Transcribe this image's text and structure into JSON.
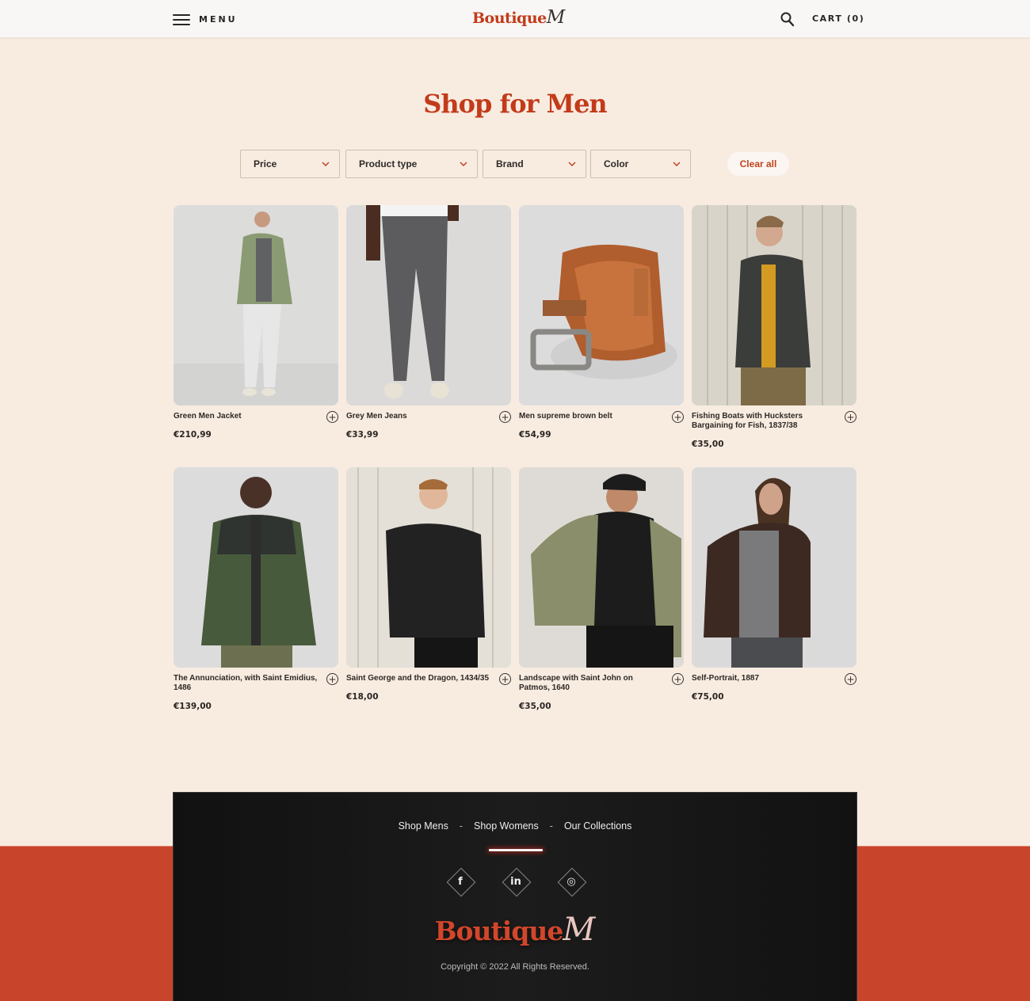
{
  "header": {
    "menu_label": "MENU",
    "logo_main": "Boutique",
    "logo_script": "M",
    "cart_label": "CART (0)",
    "icons": {
      "menu": "hamburger-icon",
      "search": "search-icon"
    }
  },
  "page": {
    "title": "Shop for Men"
  },
  "filters": {
    "items": [
      {
        "label": "Price"
      },
      {
        "label": "Product type"
      },
      {
        "label": "Brand"
      },
      {
        "label": "Color"
      }
    ],
    "clear_all": "Clear all"
  },
  "products": [
    {
      "name": "Green Men Jacket",
      "price": "€210,99"
    },
    {
      "name": "Grey Men Jeans",
      "price": "€33,99"
    },
    {
      "name": "Men supreme brown belt",
      "price": "€54,99"
    },
    {
      "name": "Fishing Boats with Hucksters Bargaining for Fish, 1837/38",
      "price": "€35,00"
    },
    {
      "name": "The Annunciation, with Saint Emidius, 1486",
      "price": "€139,00"
    },
    {
      "name": "Saint George and the Dragon, 1434/35",
      "price": "€18,00"
    },
    {
      "name": "Landscape with Saint John on Patmos, 1640",
      "price": "€35,00"
    },
    {
      "name": "Self-Portrait, 1887",
      "price": "€75,00"
    }
  ],
  "add_symbol": "+",
  "footer": {
    "nav": [
      "Shop Mens",
      "Shop Womens",
      "Our Collections"
    ],
    "separator": "-",
    "social": [
      {
        "name": "facebook",
        "glyph": "f"
      },
      {
        "name": "linkedin",
        "glyph": "in"
      },
      {
        "name": "instagram",
        "glyph": "◎"
      }
    ],
    "logo_main": "Boutique",
    "logo_script": "M",
    "copyright": "Copyright © 2022 All Rights Reserved."
  },
  "colors": {
    "accent": "#c23b1a",
    "page_bg": "#f8ece1",
    "footer_band": "#c8452b",
    "footer_dark": "#151515"
  }
}
